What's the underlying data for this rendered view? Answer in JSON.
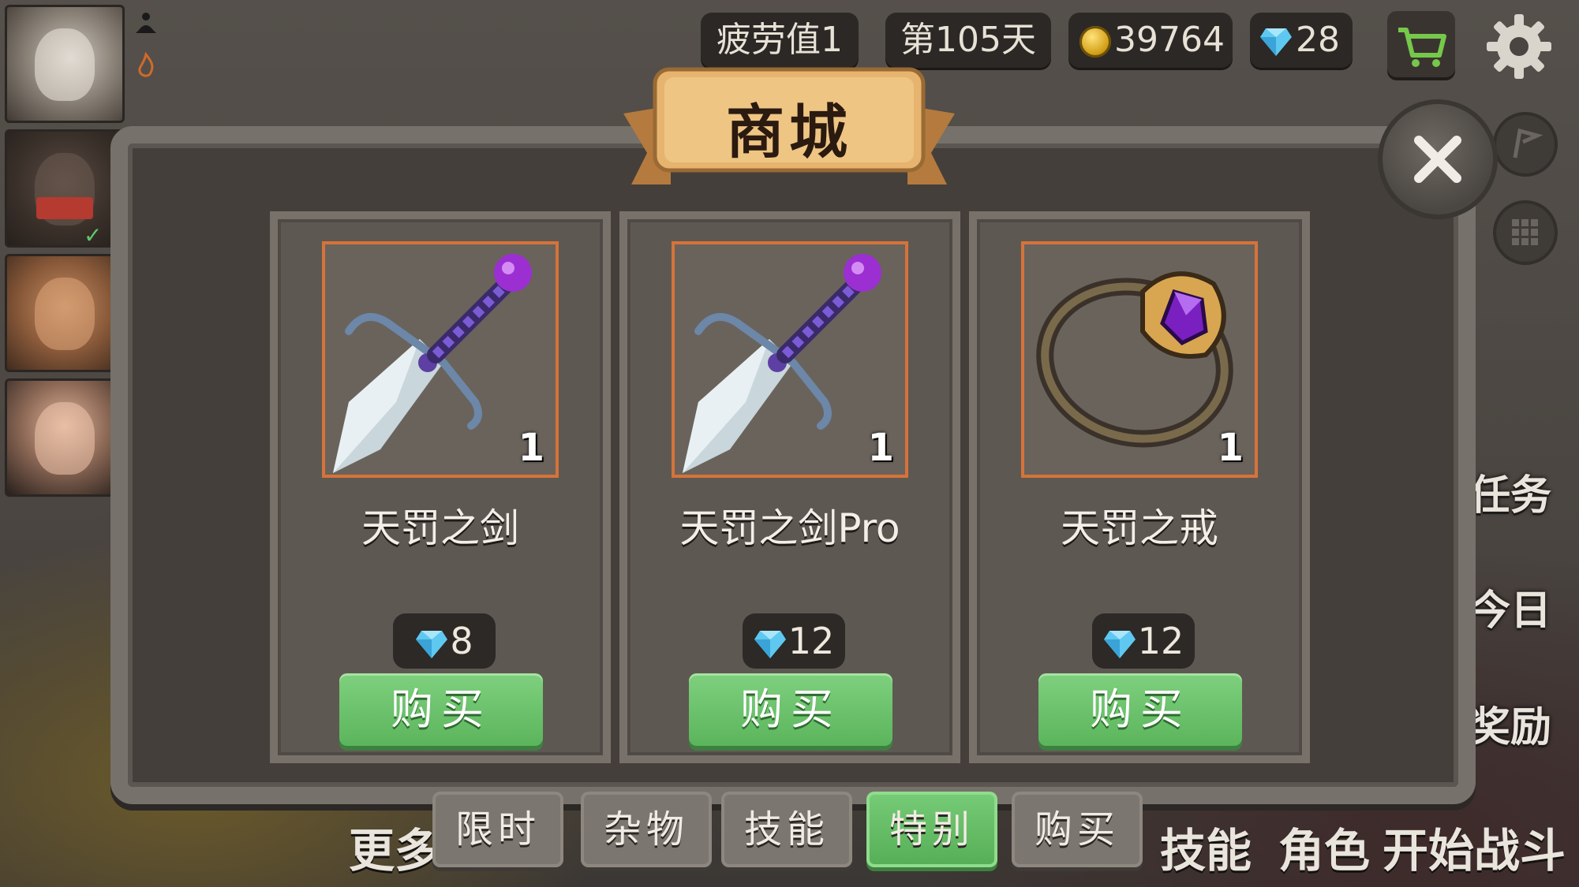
{
  "status_bar": {
    "fatigue": "疲劳值1",
    "day": "第105天",
    "gold": "39764",
    "gems": "28"
  },
  "shop": {
    "title": "商城",
    "items": [
      {
        "name": "天罚之剑",
        "count": "1",
        "price": "8",
        "icon": "sword-icon"
      },
      {
        "name": "天罚之剑Pro",
        "count": "1",
        "price": "12",
        "icon": "sword-icon"
      },
      {
        "name": "天罚之戒",
        "count": "1",
        "price": "12",
        "icon": "ring-icon"
      }
    ],
    "buy_label": "购买"
  },
  "tabs": [
    {
      "label": "限时",
      "active": false
    },
    {
      "label": "杂物",
      "active": false
    },
    {
      "label": "技能",
      "active": false
    },
    {
      "label": "特别",
      "active": true
    },
    {
      "label": "购买",
      "active": false
    }
  ],
  "side_menu": {
    "task": "任务",
    "today": "今日",
    "reward": "奖励"
  },
  "bottom_bar": {
    "more": "更多",
    "skill": "技能",
    "role": "角色",
    "start_battle": "开始战斗"
  },
  "colors": {
    "accent_green": "#5bb55c",
    "frame_orange": "#d6733a",
    "panel_bg": "#443f3a"
  }
}
